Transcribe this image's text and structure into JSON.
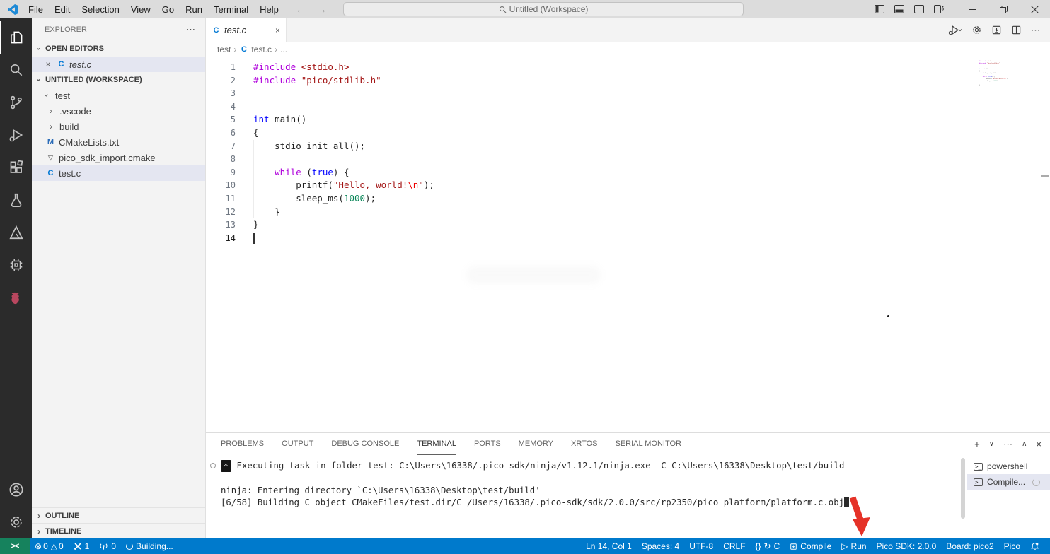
{
  "colors": {
    "status_bar": "#007acc",
    "remote_indicator": "#16825d",
    "activity_bar": "#2b2b2b",
    "titlebar": "#dcdcdc",
    "selection": "#e4e6f1",
    "annotation_arrow": "#e53228"
  },
  "title_bar": {
    "menus": [
      "File",
      "Edit",
      "Selection",
      "View",
      "Go",
      "Run",
      "Terminal",
      "Help"
    ],
    "search_text": "Untitled (Workspace)"
  },
  "sidebar": {
    "title": "EXPLORER",
    "open_editors_label": "OPEN EDITORS",
    "workspace_label": "UNTITLED (WORKSPACE)",
    "outline_label": "OUTLINE",
    "timeline_label": "TIMELINE",
    "open_editor_file": "test.c",
    "tree": [
      {
        "label": "test",
        "indent": 1,
        "chevron": "down"
      },
      {
        "label": ".vscode",
        "indent": 2,
        "chevron": "right"
      },
      {
        "label": "build",
        "indent": 2,
        "chevron": "right"
      },
      {
        "label": "CMakeLists.txt",
        "indent": 2,
        "icon": "m"
      },
      {
        "label": "pico_sdk_import.cmake",
        "indent": 2,
        "icon": "cmake"
      },
      {
        "label": "test.c",
        "indent": 2,
        "icon": "c",
        "selected": true
      }
    ]
  },
  "editor": {
    "tab_label": "test.c",
    "breadcrumb_root": "test",
    "breadcrumb_file": "test.c",
    "breadcrumb_more": "...",
    "code": {
      "current_line": 14,
      "lines": [
        {
          "n": 1,
          "t": [
            [
              "pp",
              "#include"
            ],
            [
              "pl",
              " "
            ],
            [
              "str",
              "<stdio.h>"
            ]
          ]
        },
        {
          "n": 2,
          "t": [
            [
              "pp",
              "#include"
            ],
            [
              "pl",
              " "
            ],
            [
              "str",
              "\"pico/stdlib.h\""
            ]
          ]
        },
        {
          "n": 3,
          "t": []
        },
        {
          "n": 4,
          "t": []
        },
        {
          "n": 5,
          "t": [
            [
              "kw",
              "int"
            ],
            [
              "pl",
              " main()"
            ]
          ]
        },
        {
          "n": 6,
          "t": [
            [
              "pl",
              "{"
            ]
          ]
        },
        {
          "n": 7,
          "t": [
            [
              "pl",
              "    stdio_init_all();"
            ]
          ],
          "g": [
            0
          ]
        },
        {
          "n": 8,
          "t": [],
          "g": [
            0
          ]
        },
        {
          "n": 9,
          "t": [
            [
              "pl",
              "    "
            ],
            [
              "ctrl",
              "while"
            ],
            [
              "pl",
              " ("
            ],
            [
              "kw",
              "true"
            ],
            [
              "pl",
              ") {"
            ]
          ],
          "g": [
            0
          ]
        },
        {
          "n": 10,
          "t": [
            [
              "pl",
              "        printf("
            ],
            [
              "str",
              "\"Hello, world!"
            ],
            [
              "esc",
              "\\n"
            ],
            [
              "str",
              "\""
            ],
            [
              "pl",
              ");"
            ]
          ],
          "g": [
            0,
            4
          ]
        },
        {
          "n": 11,
          "t": [
            [
              "pl",
              "        sleep_ms("
            ],
            [
              "num",
              "1000"
            ],
            [
              "pl",
              ");"
            ]
          ],
          "g": [
            0,
            4
          ]
        },
        {
          "n": 12,
          "t": [
            [
              "pl",
              "    }"
            ]
          ],
          "g": [
            0
          ]
        },
        {
          "n": 13,
          "t": [
            [
              "pl",
              "}"
            ]
          ]
        },
        {
          "n": 14,
          "t": [],
          "current": true
        }
      ]
    }
  },
  "panel": {
    "tabs": [
      "PROBLEMS",
      "OUTPUT",
      "DEBUG CONSOLE",
      "TERMINAL",
      "PORTS",
      "MEMORY",
      "XRTOS",
      "SERIAL MONITOR"
    ],
    "active_tab": "TERMINAL",
    "terminal": {
      "lines": [
        {
          "badge": "*",
          "decoration": true,
          "text": "Executing task in folder test: C:\\Users\\16338/.pico-sdk/ninja/v1.12.1/ninja.exe -C C:\\Users\\16338\\Desktop\\test/build"
        },
        {
          "text": ""
        },
        {
          "text": "ninja: Entering directory `C:\\Users\\16338\\Desktop\\test/build'"
        },
        {
          "text": "[6/58] Building C object CMakeFiles/test.dir/C_/Users/16338/.pico-sdk/sdk/2.0.0/src/rp2350/pico_platform/platform.c.obj",
          "cursor": true
        }
      ],
      "list": [
        {
          "label": "powershell"
        },
        {
          "label": "Compile...",
          "selected": true,
          "spinner": true
        }
      ]
    }
  },
  "status_bar": {
    "errors": "0",
    "warnings": "0",
    "tasks": "1",
    "ports": "0",
    "building": "Building...",
    "line_col": "Ln 14, Col 1",
    "spaces": "Spaces: 4",
    "encoding": "UTF-8",
    "eol": "CRLF",
    "braces": "{}",
    "language": "C",
    "compile": "Compile",
    "run": "Run",
    "sdk": "Pico SDK: 2.0.0",
    "board": "Board: pico2",
    "pico": "Pico"
  }
}
